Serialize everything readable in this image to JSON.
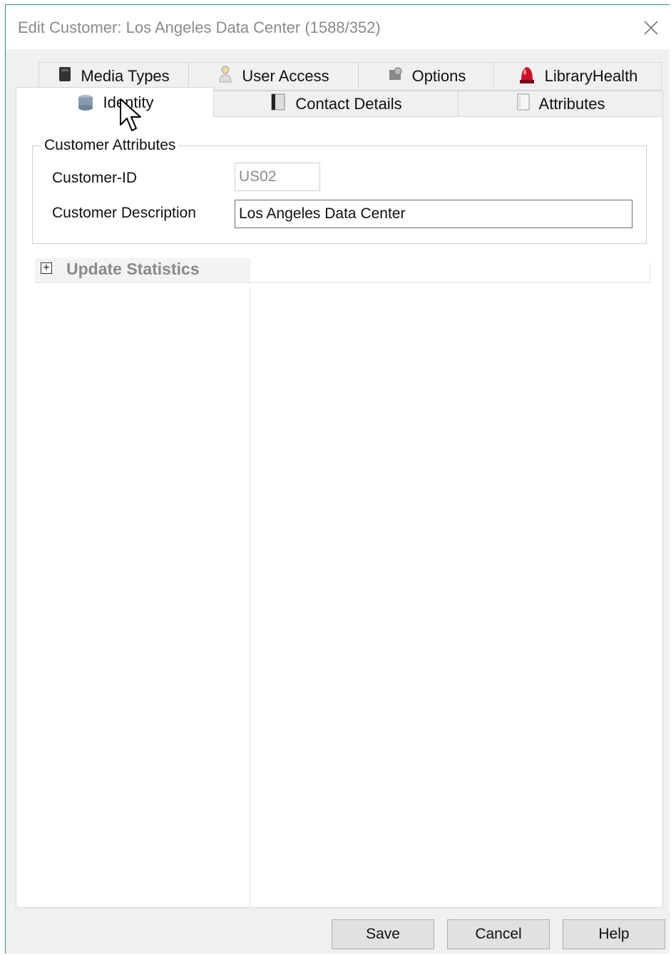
{
  "window": {
    "title": "Edit Customer: Los Angeles Data Center (1588/352)"
  },
  "tabs": {
    "row1": [
      {
        "label": "Media Types",
        "icon": "media-box-icon"
      },
      {
        "label": "User Access",
        "icon": "user-icon"
      },
      {
        "label": "Options",
        "icon": "options-icon"
      },
      {
        "label": "LibraryHealth",
        "icon": "alarm-light-icon"
      }
    ],
    "row2": [
      {
        "label": "Identity",
        "icon": "server-icon",
        "active": true
      },
      {
        "label": "Contact Details",
        "icon": "address-book-icon"
      },
      {
        "label": "Attributes",
        "icon": "document-icon"
      }
    ]
  },
  "identity": {
    "group_title": "Customer Attributes",
    "customer_id_label": "Customer-ID",
    "customer_id_value": "US02",
    "description_label": "Customer Description",
    "description_value": "Los Angeles Data Center"
  },
  "update_statistics": {
    "title": "Update Statistics",
    "expand_symbol": "+"
  },
  "buttons": {
    "save": "Save",
    "cancel": "Cancel",
    "help": "Help"
  },
  "colors": {
    "window_border": "#2f8a8e",
    "libraryhealth_icon": "#c8102e"
  }
}
